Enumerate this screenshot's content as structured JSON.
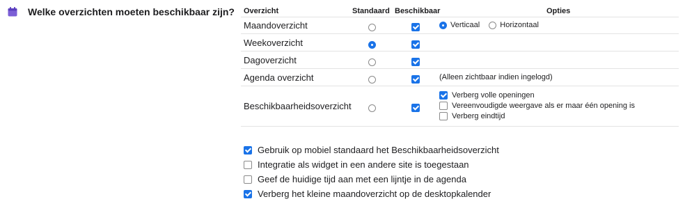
{
  "question": {
    "icon": "calendar-icon",
    "label": "Welke overzichten moeten beschikbaar zijn?"
  },
  "table": {
    "headers": {
      "overview": "Overzicht",
      "default": "Standaard",
      "available": "Beschikbaar",
      "options": "Opties"
    },
    "rows": [
      {
        "name": "Maandoverzicht",
        "default": false,
        "available": true,
        "orientation": {
          "vertical_label": "Verticaal",
          "horizontal_label": "Horizontaal",
          "selected": "vertical"
        }
      },
      {
        "name": "Weekoverzicht",
        "default": true,
        "available": true
      },
      {
        "name": "Dagoverzicht",
        "default": false,
        "available": true
      },
      {
        "name": "Agenda overzicht",
        "default": false,
        "available": true,
        "note": "(Alleen zichtbaar indien ingelogd)"
      },
      {
        "name": "Beschikbaarheidsoverzicht",
        "default": false,
        "available": true,
        "options": [
          {
            "label": "Verberg volle openingen",
            "checked": true
          },
          {
            "label": "Vereenvoudigde weergave als er maar één opening is",
            "checked": false
          },
          {
            "label": "Verberg eindtijd",
            "checked": false
          }
        ]
      }
    ]
  },
  "extra_options": [
    {
      "label": "Gebruik op mobiel standaard het Beschikbaarheidsoverzicht",
      "checked": true
    },
    {
      "label": "Integratie als widget in een andere site is toegestaan",
      "checked": false
    },
    {
      "label": "Geef de huidige tijd aan met een lijntje in de agenda",
      "checked": false
    },
    {
      "label": "Verberg het kleine maandoverzicht op de desktopkalender",
      "checked": true
    }
  ],
  "colors": {
    "accent": "#1a73e8",
    "icon": "#7b5fd6",
    "divider": "#e3e3e3"
  }
}
